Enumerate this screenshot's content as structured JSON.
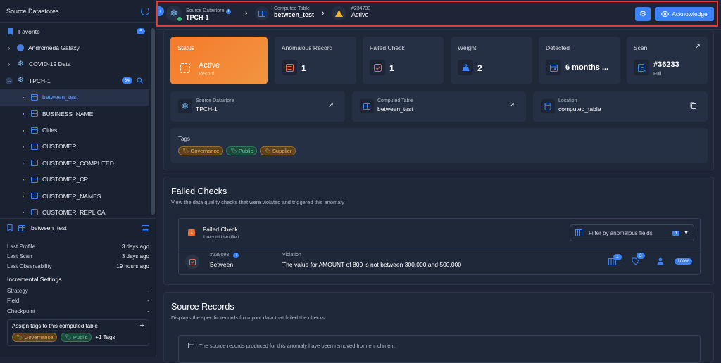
{
  "sidebar": {
    "title": "Source Datastores",
    "favorite": {
      "label": "Favorite",
      "count": "5"
    },
    "datastores": [
      {
        "label": "Andromeda Galaxy"
      },
      {
        "label": "COVID-19 Data"
      },
      {
        "label": "TPCH-1",
        "count": "34"
      }
    ],
    "tables": [
      {
        "label": "between_test"
      },
      {
        "label": "BUSINESS_NAME"
      },
      {
        "label": "Cities"
      },
      {
        "label": "CUSTOMER"
      },
      {
        "label": "CUSTOMER_COMPUTED"
      },
      {
        "label": "CUSTOMER_CP"
      },
      {
        "label": "CUSTOMER_NAMES"
      },
      {
        "label": "CUSTOMER_REPLICA"
      }
    ],
    "detail": {
      "name": "between_test",
      "stats": [
        {
          "label": "Last Profile",
          "value": "3 days ago"
        },
        {
          "label": "Last Scan",
          "value": "3 days ago"
        },
        {
          "label": "Last Observability",
          "value": "19 hours ago"
        }
      ],
      "incremental_title": "Incremental Settings",
      "incremental": [
        {
          "label": "Strategy",
          "value": "-"
        },
        {
          "label": "Field",
          "value": "-"
        },
        {
          "label": "Checkpoint",
          "value": "-"
        }
      ],
      "assign_label": "Assign tags to this computed table",
      "tags": [
        "Governance",
        "Public"
      ],
      "more_tags": "+1 Tags"
    }
  },
  "topbar": {
    "crumbs": [
      {
        "label": "Source Datastore",
        "value": "TPCH-1"
      },
      {
        "label": "Computed Table",
        "value": "between_test"
      },
      {
        "label": "#234733",
        "value": "Active"
      }
    ],
    "ack_label": "Acknowledge"
  },
  "cards": {
    "status": {
      "title": "Status",
      "value": "Active",
      "sub": "Record"
    },
    "anomalous": {
      "title": "Anomalous Record",
      "value": "1"
    },
    "failed": {
      "title": "Failed Check",
      "value": "1"
    },
    "weight": {
      "title": "Weight",
      "value": "2"
    },
    "detected": {
      "title": "Detected",
      "value": "6 months ..."
    },
    "scan": {
      "title": "Scan",
      "value": "#36233",
      "sub": "Full"
    }
  },
  "info": {
    "datastore": {
      "label": "Source Datastore",
      "value": "TPCH-1"
    },
    "table": {
      "label": "Computed Table",
      "value": "between_test"
    },
    "location": {
      "label": "Location",
      "value": "computed_table"
    }
  },
  "tags": {
    "title": "Tags",
    "items": [
      "Governance",
      "Public",
      "Supplier"
    ]
  },
  "failed_checks": {
    "title": "Failed Checks",
    "subtitle": "View the data quality checks that were violated and triggered this anomaly",
    "header_title": "Failed Check",
    "header_count": "1",
    "header_sub": "1 record identified",
    "filter_label": "Filter by anomalous fields",
    "filter_count": "1",
    "check": {
      "id": "#239098",
      "name": "Between",
      "violation_label": "Violation",
      "violation": "The value for AMOUNT of 800 is not between 300.000 and 500.000",
      "badge1": "1",
      "badge2": "3",
      "percent": "100%"
    }
  },
  "source_records": {
    "title": "Source Records",
    "subtitle": "Displays the specific records from your data that failed the checks",
    "notice": "The source records produced for this anomaly have been removed from enrichment"
  }
}
